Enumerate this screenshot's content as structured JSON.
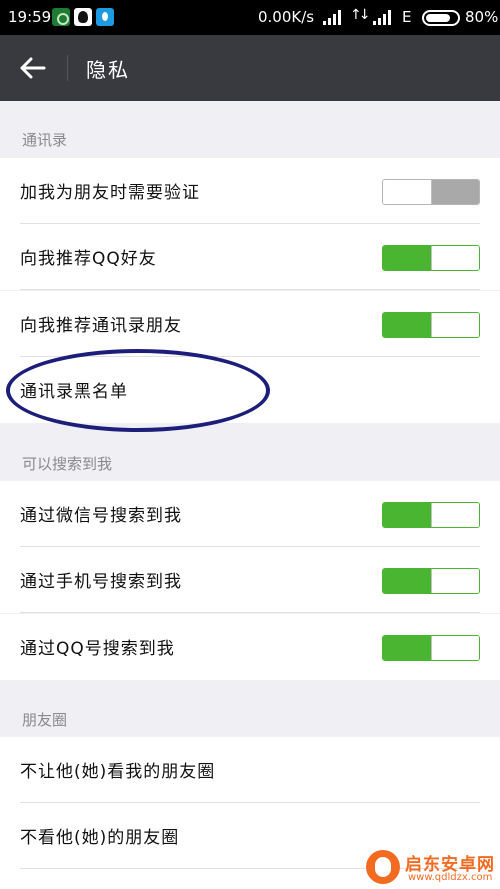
{
  "status_bar": {
    "time": "19:59",
    "net_speed": "0.00K/s",
    "network_type": "E",
    "battery": "80%",
    "battery_level": 0.8,
    "app_icons": [
      "android-app-icon",
      "qq-penguin-icon",
      "droplet-app-icon"
    ]
  },
  "header": {
    "title": "隐私",
    "back_icon": "arrow-left-icon"
  },
  "sections": {
    "contacts": {
      "title": "通讯录",
      "rows": [
        {
          "label": "加我为朋友时需要验证",
          "toggle": "off"
        },
        {
          "label": "向我推荐QQ好友",
          "toggle": "on"
        },
        {
          "label": "向我推荐通讯录朋友",
          "toggle": "on"
        },
        {
          "label": "通讯录黑名单"
        }
      ]
    },
    "search": {
      "title": "可以搜索到我",
      "rows": [
        {
          "label": "通过微信号搜索到我",
          "toggle": "on"
        },
        {
          "label": "通过手机号搜索到我",
          "toggle": "on"
        },
        {
          "label": "通过QQ号搜索到我",
          "toggle": "on"
        }
      ]
    },
    "moments": {
      "title": "朋友圈",
      "rows": [
        {
          "label": "不让他(她)看我的朋友圈"
        },
        {
          "label": "不看他(她)的朋友圈"
        }
      ]
    }
  },
  "watermark": {
    "title": "启东安卓网",
    "url": "www.qdldzx.com"
  },
  "colors": {
    "toggle_on": "#49b531",
    "toggle_off": "#a9a9a9",
    "header_bg": "#393a3f",
    "annotation": "#1c1e7a",
    "watermark": "#f36b21"
  }
}
